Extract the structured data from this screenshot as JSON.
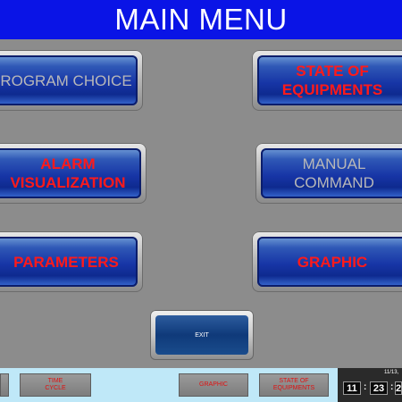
{
  "header": {
    "title": "MAIN MENU"
  },
  "menu": {
    "program_choice": "ROGRAM CHOICE",
    "state_of_equipments": "STATE OF\nEQUIPMENTS",
    "alarm_visualization": "ALARM\nVISUALIZATION",
    "manual_command": "MANUAL\nCOMMAND",
    "parameters": "PARAMETERS",
    "graphic": "GRAPHIC",
    "exit": "EXIT"
  },
  "nav": {
    "time_cycle": "TIME\nCYCLE",
    "graphic": "GRAPHIC",
    "state_of_equipments": "STATE OF\nEQUIPMENTS"
  },
  "clock": {
    "date": "11/13,",
    "hours": "11",
    "minutes": "23",
    "seconds": "2"
  },
  "colors": {
    "title_bar": "#0a14e6",
    "background": "#8c8c8c",
    "active_label": "#ff1a1a",
    "disabled_label": "#b8b8b8",
    "bottom_bar": "#bfe8f8"
  }
}
